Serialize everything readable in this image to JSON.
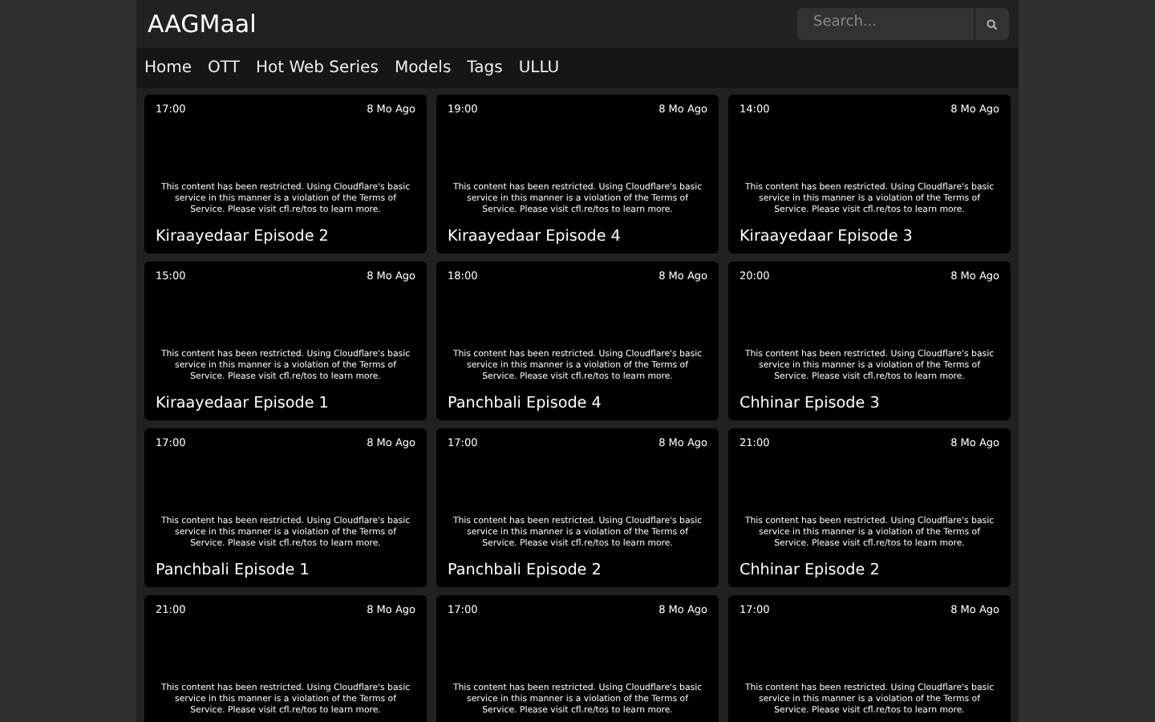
{
  "site_title": "AAGMaal",
  "search": {
    "placeholder": "Search..."
  },
  "nav": [
    "Home",
    "OTT",
    "Hot Web Series",
    "Models",
    "Tags",
    "ULLU"
  ],
  "videos": [
    {
      "duration": "17:00",
      "age": "8 Mo Ago",
      "notice": "This content has been restricted. Using Cloudflare's basic service in this manner is a violation of the Terms of Service. Please visit cfl.re/tos to learn more.",
      "title": "Kiraayedaar Episode 2"
    },
    {
      "duration": "19:00",
      "age": "8 Mo Ago",
      "notice": "This content has been restricted. Using Cloudflare's basic service in this manner is a violation of the Terms of Service. Please visit cfl.re/tos to learn more.",
      "title": "Kiraayedaar Episode 4"
    },
    {
      "duration": "14:00",
      "age": "8 Mo Ago",
      "notice": "This content has been restricted. Using Cloudflare's basic service in this manner is a violation of the Terms of Service. Please visit cfl.re/tos to learn more.",
      "title": "Kiraayedaar Episode 3"
    },
    {
      "duration": "15:00",
      "age": "8 Mo Ago",
      "notice": "This content has been restricted. Using Cloudflare's basic service in this manner is a violation of the Terms of Service. Please visit cfl.re/tos to learn more.",
      "title": "Kiraayedaar Episode 1"
    },
    {
      "duration": "18:00",
      "age": "8 Mo Ago",
      "notice": "This content has been restricted. Using Cloudflare's basic service in this manner is a violation of the Terms of Service. Please visit cfl.re/tos to learn more.",
      "title": "Panchbali Episode 4"
    },
    {
      "duration": "20:00",
      "age": "8 Mo Ago",
      "notice": "This content has been restricted. Using Cloudflare's basic service in this manner is a violation of the Terms of Service. Please visit cfl.re/tos to learn more.",
      "title": "Chhinar Episode 3"
    },
    {
      "duration": "17:00",
      "age": "8 Mo Ago",
      "notice": "This content has been restricted. Using Cloudflare's basic service in this manner is a violation of the Terms of Service. Please visit cfl.re/tos to learn more.",
      "title": "Panchbali Episode 1"
    },
    {
      "duration": "17:00",
      "age": "8 Mo Ago",
      "notice": "This content has been restricted. Using Cloudflare's basic service in this manner is a violation of the Terms of Service. Please visit cfl.re/tos to learn more.",
      "title": "Panchbali Episode 2"
    },
    {
      "duration": "21:00",
      "age": "8 Mo Ago",
      "notice": "This content has been restricted. Using Cloudflare's basic service in this manner is a violation of the Terms of Service. Please visit cfl.re/tos to learn more.",
      "title": "Chhinar Episode 2"
    },
    {
      "duration": "21:00",
      "age": "8 Mo Ago",
      "notice": "This content has been restricted. Using Cloudflare's basic service in this manner is a violation of the Terms of Service. Please visit cfl.re/tos to learn more."
    },
    {
      "duration": "17:00",
      "age": "8 Mo Ago",
      "notice": "This content has been restricted. Using Cloudflare's basic service in this manner is a violation of the Terms of Service. Please visit cfl.re/tos to learn more."
    },
    {
      "duration": "17:00",
      "age": "8 Mo Ago",
      "notice": "This content has been restricted. Using Cloudflare's basic service in this manner is a violation of the Terms of Service. Please visit cfl.re/tos to learn more."
    }
  ]
}
